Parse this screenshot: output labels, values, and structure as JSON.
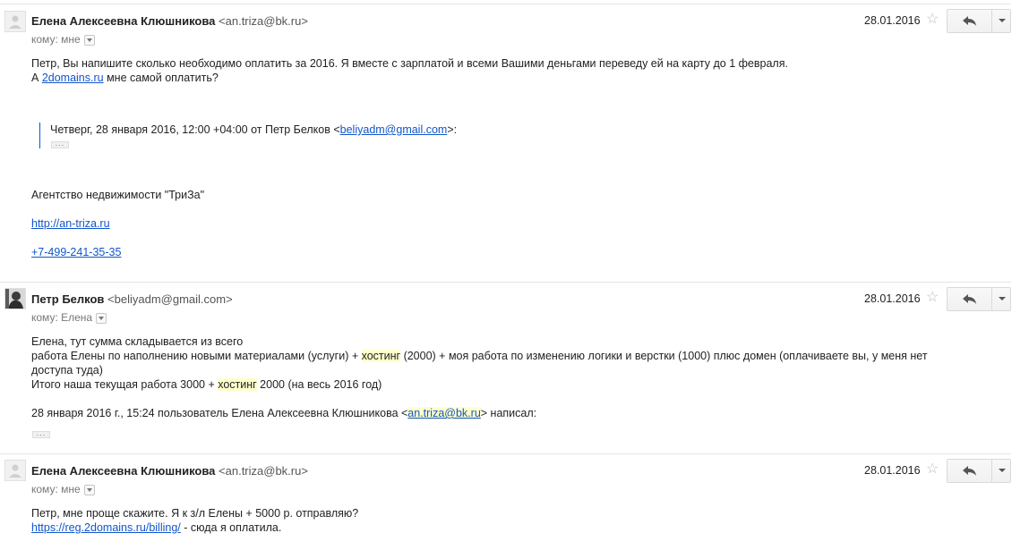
{
  "messages": [
    {
      "sender_name": "Елена Алексеевна Клюшникова",
      "sender_email": "<an.triza@bk.ru>",
      "to_label": "кому: мне",
      "date": "28.01.2016",
      "body": [
        "Петр, Вы напишите сколько необходимо оплатить за 2016. Я вместе с зарплатой и всеми Вашими деньгами переведу ей на карту до 1 февраля."
      ],
      "line2_prefix": "А ",
      "line2_link": "2domains.ru",
      "line2_suffix": " мне самой оплатить?",
      "quote_prefix": "Четверг, 28 января 2016, 12:00 +04:00 от Петр Белков <",
      "quote_email": "beliyadm@gmail.com",
      "quote_suffix": ">:",
      "ellipsis": "...",
      "signature_company": "Агентство недвижимости \"ТриЗа\"",
      "signature_site": "http://an-triza.ru",
      "signature_phone": "+7-499-241-35-35"
    },
    {
      "sender_name": "Петр Белков",
      "sender_email": "<beliyadm@gmail.com>",
      "to_label": "кому: Елена",
      "date": "28.01.2016",
      "line1": "Елена, тут сумма складывается из всего",
      "line2_a": "работа Елены по наполнению новыми материалами (услуги) + ",
      "line2_hl": "хостинг",
      "line2_b": " (2000) + моя работа по изменению логики и верстки (1000) плюс домен (оплачиваете вы, у меня нет",
      "line3": "доступа туда)",
      "line4_a": "Итого наша текущая работа 3000 + ",
      "line4_hl": "хостинг",
      "line4_b": " 2000 (на весь 2016 год)",
      "quote_a": "28 января 2016 г., 15:24 пользователь Елена Алексеевна Клюшникова <",
      "quote_email": "an.triza@bk.ru",
      "quote_b": "> написал:",
      "ellipsis": "..."
    },
    {
      "sender_name": "Елена Алексеевна Клюшникова",
      "sender_email": "<an.triza@bk.ru>",
      "to_label": "кому: мне",
      "date": "28.01.2016",
      "line1": "Петр, мне проще скажите. Я к з/л Елены + 5000 р. отправляю?",
      "link": "https://reg.2domains.ru/billing/",
      "line2_suffix": " - сюда я оплатила."
    }
  ],
  "icons": {
    "star": "star-icon",
    "reply": "reply-icon",
    "more": "chevron-down-icon",
    "avatar_default": "person-icon"
  }
}
